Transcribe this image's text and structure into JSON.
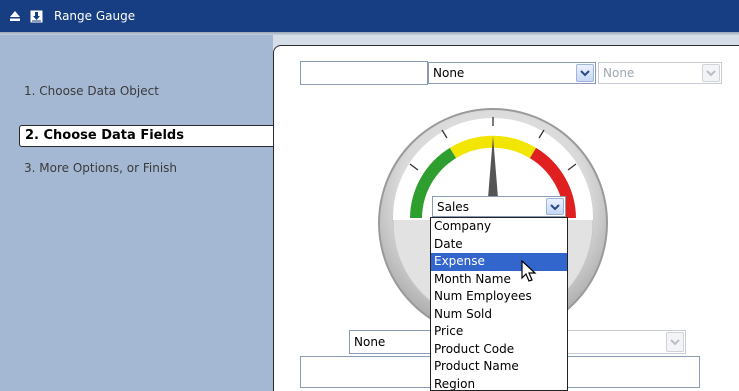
{
  "window": {
    "title": "Range Gauge"
  },
  "wizard": {
    "steps": [
      {
        "label": "1. Choose Data Object"
      },
      {
        "label": "2. Choose Data Fields"
      },
      {
        "label": "3. More Options, or Finish"
      }
    ]
  },
  "top_row": {
    "field_value": "",
    "select1": "None",
    "select2": "None"
  },
  "gauge": {
    "field_select": "Sales",
    "zone_colors": [
      "#2e9e2e",
      "#f2e600",
      "#e02020"
    ],
    "needle_level": 0.5
  },
  "dropdown": {
    "options": [
      "Company",
      "Date",
      "Expense",
      "Month Name",
      "Num Employees",
      "Num Sold",
      "Price",
      "Product Code",
      "Product Name",
      "Region"
    ],
    "highlighted": "Expense"
  },
  "bottom_row": {
    "select1": "None",
    "field_value": ""
  },
  "colors": {
    "titlebar": "#173e82",
    "sidebar": "#a4b8d4",
    "highlight": "#3366cc"
  }
}
